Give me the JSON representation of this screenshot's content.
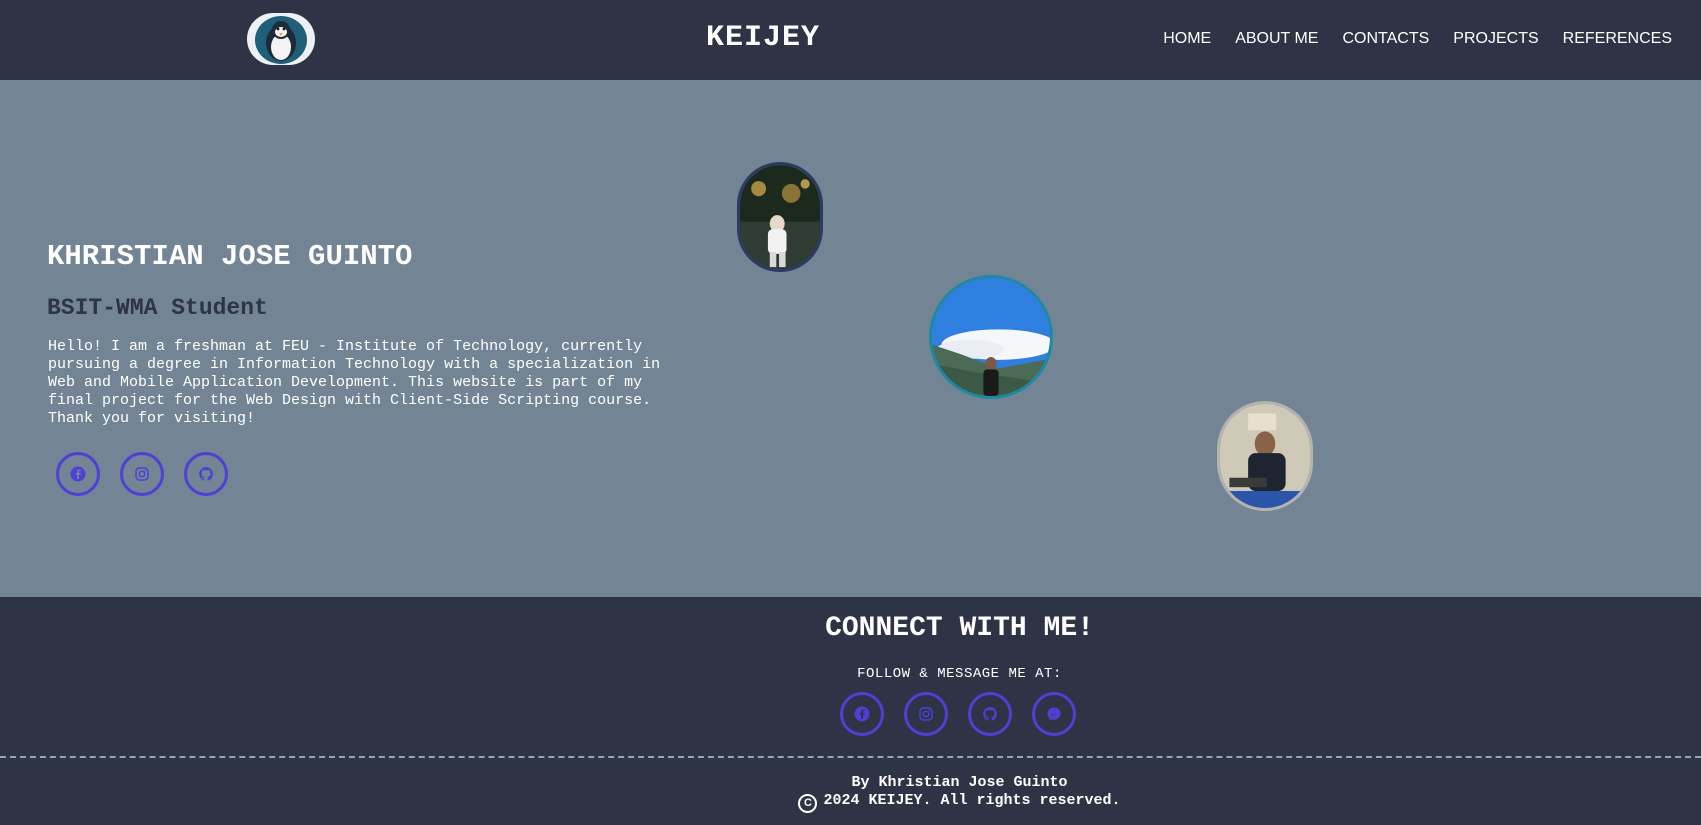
{
  "nav": {
    "brand": "KEIJEY",
    "logo_icon": "penguin-logo-icon",
    "links": [
      "HOME",
      "ABOUT ME",
      "CONTACTS",
      "PROJECTS",
      "REFERENCES"
    ]
  },
  "hero": {
    "name": "KHRISTIAN JOSE GUINTO",
    "role": "BSIT-WMA Student",
    "bio": "Hello! I am a freshman at FEU - Institute of Technology, currently pursuing a degree in Information Technology with a specialization in Web and Mobile Application Development. This website is part of my final project for the Web Design with Client-Side Scripting course. Thank you for visiting!",
    "socials": [
      "facebook-icon",
      "instagram-icon",
      "github-icon"
    ]
  },
  "footer": {
    "title": "CONNECT WITH ME!",
    "subtitle": "FOLLOW & MESSAGE ME AT:",
    "socials": [
      "facebook-icon",
      "instagram-icon",
      "github-icon",
      "messenger-icon"
    ],
    "credit": "By Khristian Jose Guinto",
    "copyright": "2024 KEIJEY. All rights reserved."
  },
  "colors": {
    "header_bg": "#2e3445",
    "hero_bg": "#738594",
    "accent": "#4f3fd6"
  }
}
